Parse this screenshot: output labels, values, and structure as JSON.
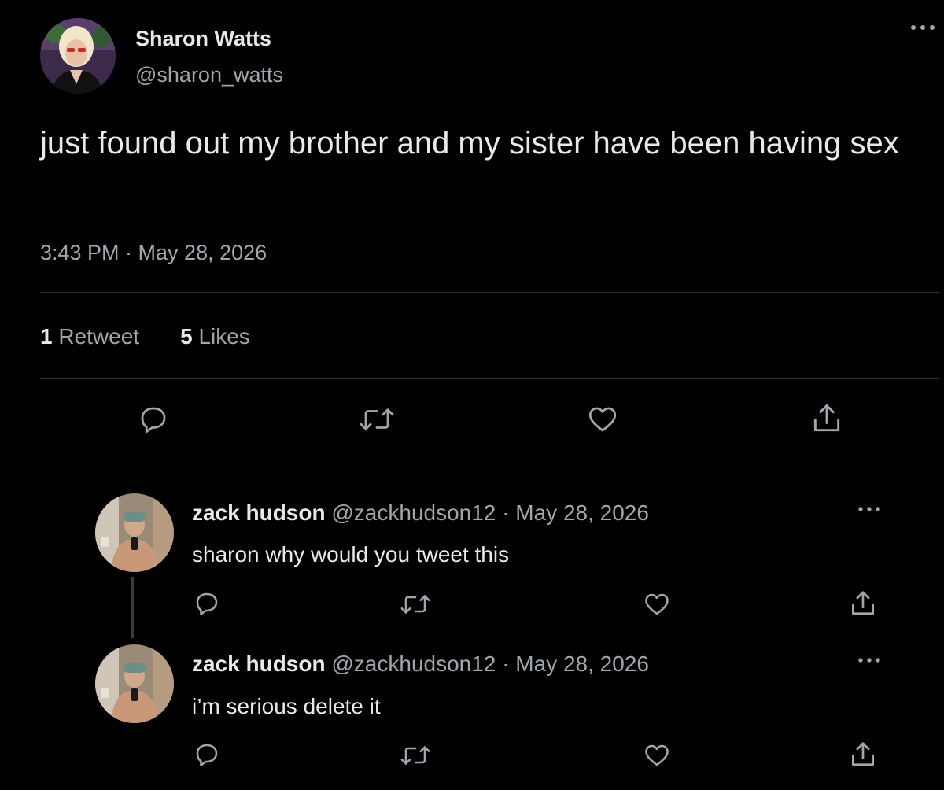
{
  "tweet": {
    "author_name": "Sharon Watts",
    "author_handle": "@sharon_watts",
    "text": "just found out my brother and my sister have been having sex",
    "timestamp": "3:43 PM · May 28, 2026",
    "retweet_count": "1",
    "retweet_label": "Retweet",
    "like_count": "5",
    "like_label": "Likes"
  },
  "actions": [
    "reply-icon",
    "retweet-icon",
    "heart-icon",
    "share-icon"
  ],
  "replies": [
    {
      "name": "zack hudson",
      "handle": "@zackhudson12",
      "separator": "·",
      "date": "May 28, 2026",
      "text": "sharon why would you tweet this"
    },
    {
      "name": "zack hudson",
      "handle": "@zackhudson12",
      "separator": "·",
      "date": "May 28, 2026",
      "text": "i’m serious delete it"
    }
  ],
  "colors": {
    "background": "#000000",
    "primary_text": "#e7e9ea",
    "secondary_text": "#a1a6ac",
    "divider": "#2a2d30",
    "icon": "#a1a6ac"
  }
}
